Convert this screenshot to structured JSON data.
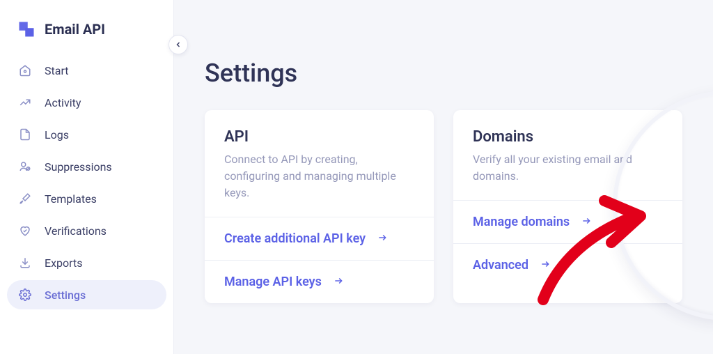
{
  "brand": {
    "title": "Email API"
  },
  "sidebar": {
    "items": [
      {
        "label": "Start"
      },
      {
        "label": "Activity"
      },
      {
        "label": "Logs"
      },
      {
        "label": "Suppressions"
      },
      {
        "label": "Templates"
      },
      {
        "label": "Verifications"
      },
      {
        "label": "Exports"
      },
      {
        "label": "Settings"
      }
    ]
  },
  "page": {
    "title": "Settings"
  },
  "cards": {
    "api": {
      "title": "API",
      "desc": "Connect to API by creating, configuring and managing multiple keys.",
      "links": [
        {
          "label": "Create additional API key"
        },
        {
          "label": "Manage API keys"
        }
      ]
    },
    "domains": {
      "title": "Domains",
      "desc": "Verify all your existing email and domains.",
      "links": [
        {
          "label": "Manage domains"
        },
        {
          "label": "Advanced"
        }
      ]
    }
  },
  "colors": {
    "accent": "#5b61e6",
    "text": "#2f3356",
    "muted": "#9598b9"
  }
}
